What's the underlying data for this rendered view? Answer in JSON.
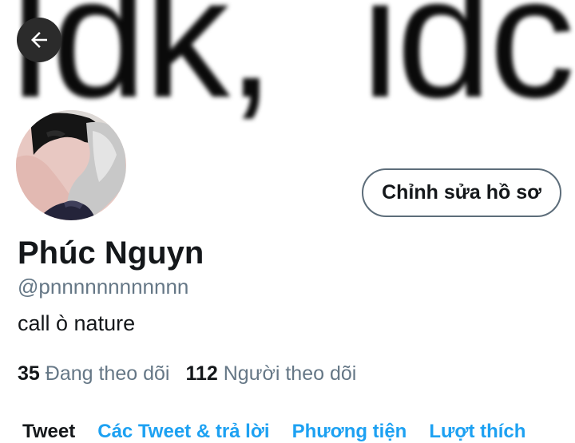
{
  "banner": {
    "text": "Idk,  idc"
  },
  "profile": {
    "name": "Phúc Nguyn",
    "handle": "@pnnnnnnnnnnnn",
    "bio": "call ò nature",
    "edit_label": "Chỉnh sửa hồ sơ"
  },
  "stats": {
    "following_count": "35",
    "following_label": "Đang theo dõi",
    "followers_count": "112",
    "followers_label": "Người theo dõi"
  },
  "tabs": [
    {
      "label": "Tweet"
    },
    {
      "label": "Các Tweet & trả lời"
    },
    {
      "label": "Phương tiện"
    },
    {
      "label": "Lượt thích"
    }
  ],
  "icons": {
    "back": "arrow-left-icon"
  },
  "colors": {
    "accent": "#1da1f2",
    "secondary_text": "#657786",
    "back_button_bg": "#2b2b2b"
  }
}
